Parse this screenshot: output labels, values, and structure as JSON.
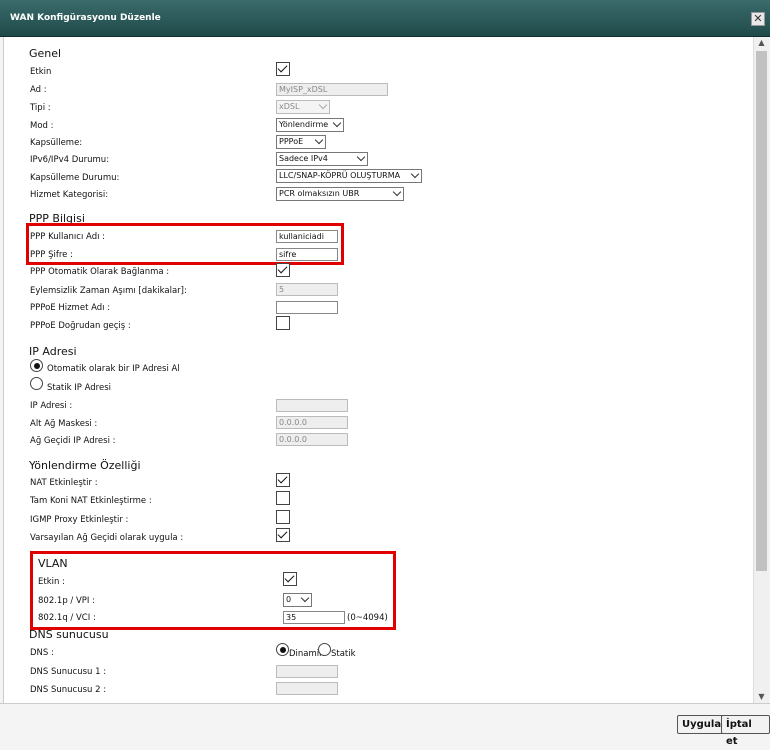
{
  "window": {
    "title": "WAN Konfigürasyonu Düzenle",
    "close": "✕"
  },
  "genel": {
    "title": "Genel",
    "etkin_label": "Etkin",
    "ad_label": "Ad :",
    "ad_value": "MyISP_xDSL",
    "tipi_label": "Tipi :",
    "tipi_value": "xDSL",
    "mod_label": "Mod :",
    "mod_value": "Yönlendirme",
    "kapsulleme_label": "Kapsülleme:",
    "kapsulleme_value": "PPPoE",
    "ipv_label": "IPv6/IPv4 Durumu:",
    "ipv_value": "Sadece IPv4",
    "kapsulleme_durumu_label": "Kapsülleme Durumu:",
    "kapsulleme_durumu_value": "LLC/SNAP-KÖPRÜ OLUŞTURMA",
    "hizmet_label": "Hizmet Kategorisi:",
    "hizmet_value": "PCR olmaksızın UBR"
  },
  "ppp": {
    "title": "PPP Bilgisi",
    "user_label": "PPP Kullanıcı Adı :",
    "user_value": "kullaniciadi",
    "pass_label": "PPP Şifre :",
    "pass_value": "sifre",
    "auto_label": "PPP Otomatik Olarak Bağlanma :",
    "idle_label": "Eylemsizlik Zaman Aşımı [dakikalar]:",
    "idle_value": "5",
    "service_label": "PPPoE Hizmet Adı :",
    "service_value": "",
    "passthrough_label": "PPPoE Doğrudan geçiş :"
  },
  "ip": {
    "title": "IP Adresi",
    "auto_label": "Otomatik olarak bir IP Adresi Al",
    "static_label": "Statik IP Adresi",
    "addr_label": "IP Adresi :",
    "addr_value": "",
    "mask_label": "Alt Ağ Maskesi :",
    "mask_value": "0.0.0.0",
    "gw_label": "Ağ Geçidi IP Adresi :",
    "gw_value": "0.0.0.0"
  },
  "routing": {
    "title": "Yönlendirme Özelliği",
    "nat_label": "NAT Etkinleştir :",
    "fullcone_label": "Tam Koni NAT Etkinleştirme :",
    "igmp_label": "IGMP Proxy Etkinleştir :",
    "default_gw_label": "Varsayılan Ağ Geçidi olarak uygula :"
  },
  "vlan": {
    "title": "VLAN",
    "etkin_label": "Etkin :",
    "vpi_label": "802.1p / VPI :",
    "vpi_value": "0",
    "vci_label": "802.1q / VCI :",
    "vci_value": "35",
    "vci_range": "(0~4094)"
  },
  "dns": {
    "title": "DNS sunucusu",
    "dns_label": "DNS :",
    "dinamik": "Dinamik",
    "statik": "Statik",
    "dns1_label": "DNS Sunucusu 1 :",
    "dns1_value": "",
    "dns2_label": "DNS Sunucusu 2 :",
    "dns2_value": ""
  },
  "buttons": {
    "apply": "Uygula",
    "cancel": "İptal et"
  }
}
